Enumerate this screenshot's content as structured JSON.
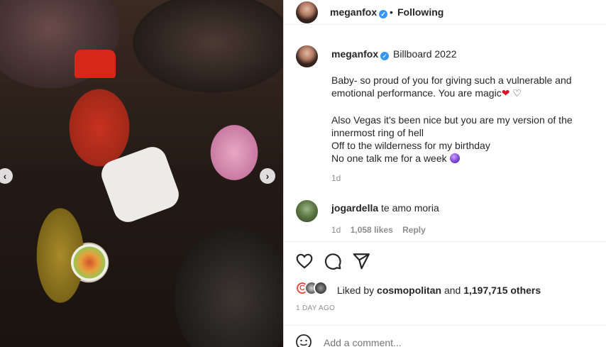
{
  "header": {
    "username": "meganfox",
    "separator": "•",
    "follow_status": "Following"
  },
  "photo": {
    "prev_arrow": "‹",
    "next_arrow": "›"
  },
  "caption": {
    "username": "meganfox",
    "title": "Billboard 2022",
    "line1": "Baby- so proud of you for giving such a vulnerable and emotional performance. You are magic",
    "heart_red": "❤",
    "heart_white": "♡",
    "line2": "Also Vegas it's been nice but you are my version of the innermost ring of hell",
    "line3": "Off to the wilderness for my birthday",
    "line4": "No one talk me for a week",
    "time": "1d"
  },
  "comment": {
    "username": "jogardella",
    "text": "te amo moria",
    "time": "1d",
    "likes": "1,058 likes",
    "reply": "Reply"
  },
  "likes": {
    "prefix": "Liked by",
    "liker": "cosmopolitan",
    "and": "and",
    "others": "1,197,715 others",
    "liker_initial": "C"
  },
  "date": "1 DAY AGO",
  "add_comment": {
    "placeholder": "Add a comment..."
  },
  "colors": {
    "verified": "#3897f0",
    "heart": "#d8132e",
    "secondary_text": "#8e8e8e"
  }
}
